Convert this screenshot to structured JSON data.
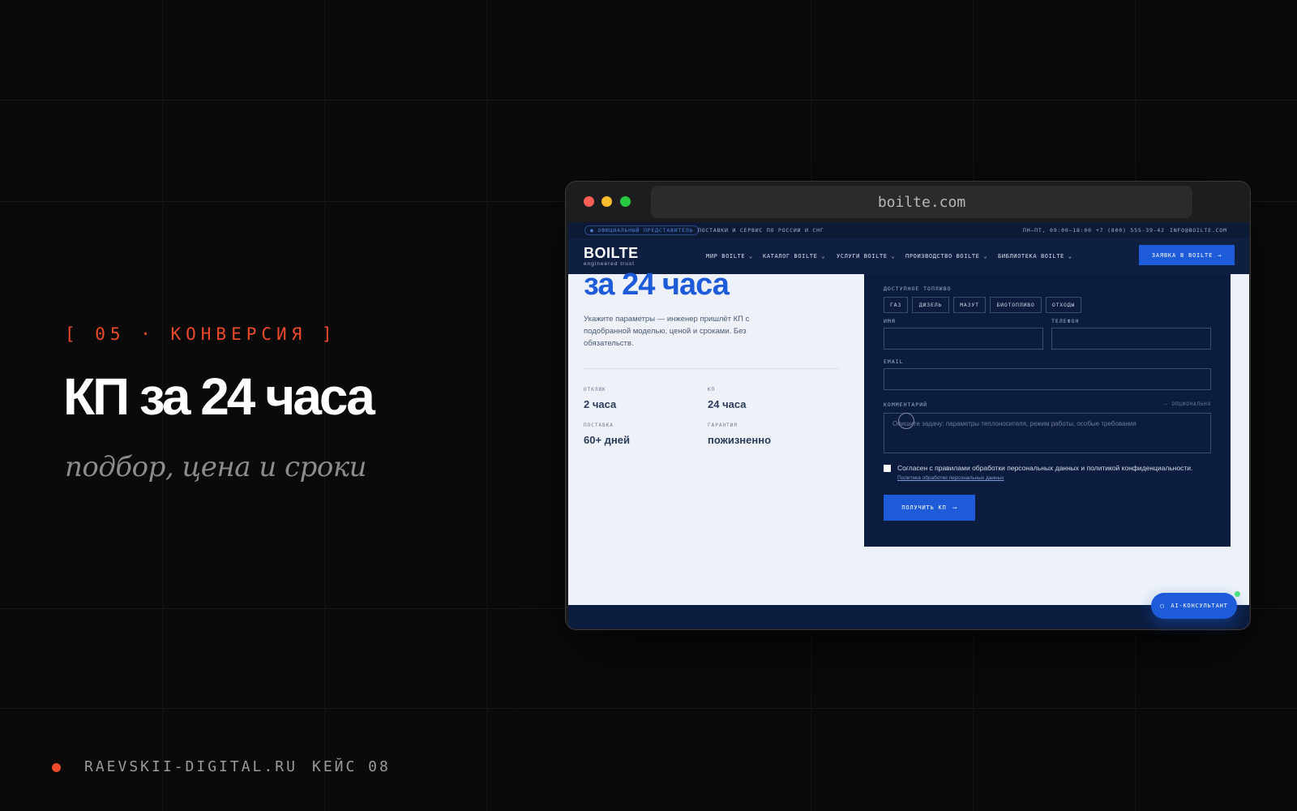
{
  "slide": {
    "eyebrow": "[ 05 · КОНВЕРСИЯ ]",
    "title": "КП за 24 часа",
    "subtitle": "подбор, цена и сроки",
    "footer_site": "RAEVSKII-DIGITAL.RU",
    "footer_case": "КЕЙС 08"
  },
  "browser": {
    "url": "boilte.com"
  },
  "site": {
    "topstrip": {
      "badge": "● ОФИЦИАЛЬНЫЙ ПРЕДСТАВИТЕЛЬ",
      "delivery": "ПОСТАВКИ И СЕРВИС ПО РОССИИ И СНГ",
      "hours": "ПН–ПТ, 09:00–18:00",
      "phone": "+7 (800) 555-39-42",
      "email": "INFO@BOILTE.COM"
    },
    "logo": "BOILTE",
    "logo_sub": "engineered trust",
    "nav": [
      "МИР BOILTE",
      "КАТАЛОГ BOILTE",
      "УСЛУГИ BOILTE",
      "ПРОИЗВОДСТВО BOILTE",
      "БИБЛИОТЕКА BOILTE"
    ],
    "cta": "ЗАЯВКА В BOILTE",
    "hero": {
      "heading": "за 24 часа",
      "description": "Укажите параметры — инженер пришлёт КП с подобранной моделью, ценой и сроками. Без обязательств.",
      "stats": [
        {
          "label": "ОТКЛИК",
          "value": "2 часа"
        },
        {
          "label": "КП",
          "value": "24 часа"
        },
        {
          "label": "ПОСТАВКА",
          "value": "60+ дней"
        },
        {
          "label": "ГАРАНТИЯ",
          "value": "пожизненно"
        }
      ]
    },
    "form": {
      "fuel_label": "ДОСТУПНОЕ ТОПЛИВО",
      "fuels": [
        "ГАЗ",
        "ДИЗЕЛЬ",
        "МАЗУТ",
        "БИОТОПЛИВО",
        "ОТХОДЫ"
      ],
      "name_label": "ИМЯ",
      "phone_label": "ТЕЛЕФОН",
      "email_label": "EMAIL",
      "comment_label": "КОММЕНТАРИЙ",
      "comment_optional": "— ОПЦИОНАЛЬНО",
      "comment_placeholder": "Опишите задачу: параметры теплоносителя, режим работы, особые требования",
      "consent": "Согласен с правилами обработки персональных данных и политикой конфиденциальности.",
      "policy_link": "Политика обработки персональных данных",
      "submit": "ПОЛУЧИТЬ КП"
    },
    "ai_button": "AI-КОНСУЛЬТАНТ"
  },
  "colors": {
    "accent": "#ea4a2a",
    "brand_blue": "#1d5bd8",
    "navy": "#0b1c3e"
  }
}
